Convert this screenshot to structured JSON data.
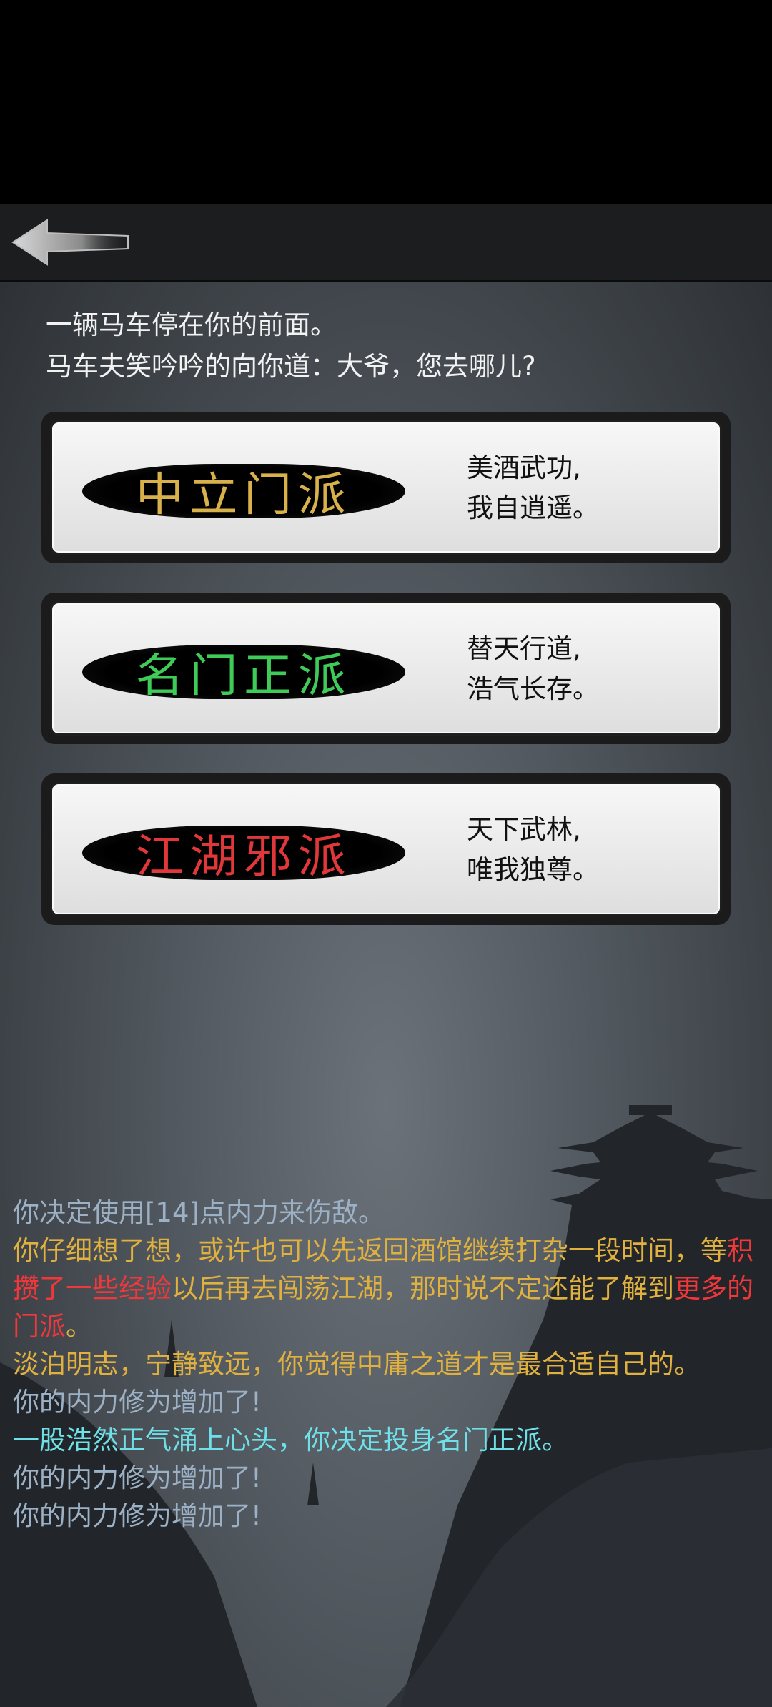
{
  "intro": {
    "line1": "一辆马车停在你的前面。",
    "line2": "马车夫笑吟吟的向你道：大爷，您去哪儿?"
  },
  "choices": [
    {
      "label": "中立门派",
      "color": "#d8b14a",
      "desc1": "美酒武功,",
      "desc2": "我自逍遥。"
    },
    {
      "label": "名门正派",
      "color": "#3fcb58",
      "desc1": "替天行道,",
      "desc2": "浩气长存。"
    },
    {
      "label": "江湖邪派",
      "color": "#e0383a",
      "desc1": "天下武林,",
      "desc2": "唯我独尊。"
    }
  ],
  "log": [
    {
      "segments": [
        {
          "text": "你决定使用[14]点内力来伤敌。",
          "color": "#9db1c6"
        }
      ]
    },
    {
      "segments": [
        {
          "text": "你仔细想了想，或许也可以先返回酒馆继续打杂一段时间，等",
          "color": "#e0b13e"
        },
        {
          "text": "积攒了一些经验",
          "color": "#f0373a"
        },
        {
          "text": "以后再去闯荡江湖，那时说不定还能了解到",
          "color": "#e0b13e"
        },
        {
          "text": "更多的门派",
          "color": "#f0373a"
        },
        {
          "text": "。",
          "color": "#e0b13e"
        }
      ]
    },
    {
      "segments": [
        {
          "text": "淡泊明志，宁静致远，你觉得中庸之道才是最合适自己的。",
          "color": "#e0b13e"
        }
      ]
    },
    {
      "segments": [
        {
          "text": "你的内力修为增加了!",
          "color": "#9db1c6"
        }
      ]
    },
    {
      "segments": [
        {
          "text": "一股浩然正气涌上心头，你决定投身名门正派。",
          "color": "#6fe0e8"
        }
      ]
    },
    {
      "segments": [
        {
          "text": "你的内力修为增加了!",
          "color": "#9db1c6"
        }
      ]
    },
    {
      "segments": [
        {
          "text": "你的内力修为增加了!",
          "color": "#9db1c6"
        }
      ]
    }
  ],
  "icons": {
    "back": "back-arrow-icon"
  }
}
